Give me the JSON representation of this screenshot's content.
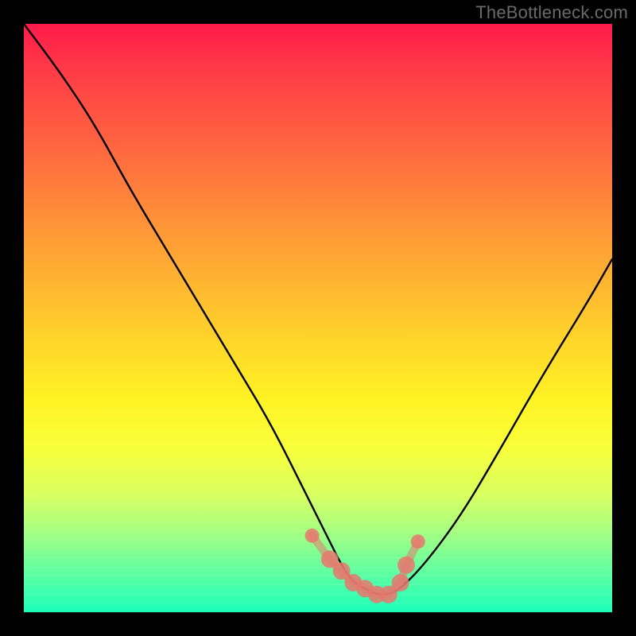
{
  "watermark": "TheBottleneck.com",
  "colors": {
    "frame": "#000000",
    "curve": "#000000",
    "marker": "#e6786f",
    "gradient_stops": [
      "#ff1a4a",
      "#ff3b47",
      "#ff6a3f",
      "#ff9a36",
      "#ffc92d",
      "#fff324",
      "#f8ff3a",
      "#d8ff60",
      "#a8ff80",
      "#6cff9c",
      "#1cffba"
    ]
  },
  "chart_data": {
    "type": "line",
    "title": "",
    "xlabel": "",
    "ylabel": "",
    "xlim": [
      0,
      100
    ],
    "ylim": [
      0,
      100
    ],
    "series": [
      {
        "name": "bottleneck-curve",
        "x": [
          0,
          6,
          12,
          18,
          24,
          30,
          36,
          42,
          48,
          52,
          54,
          56,
          58,
          60,
          62,
          64,
          68,
          74,
          80,
          88,
          96,
          100
        ],
        "y": [
          100,
          92,
          83,
          72,
          62,
          52,
          42,
          32,
          20,
          12,
          8,
          5,
          4,
          3,
          3,
          4,
          8,
          16,
          26,
          40,
          53,
          60
        ]
      }
    ],
    "markers": {
      "name": "min-region-markers",
      "x": [
        49,
        52,
        54,
        56,
        58,
        60,
        62,
        64,
        65,
        67
      ],
      "y": [
        13,
        9,
        7,
        5,
        4,
        3,
        3,
        5,
        8,
        12
      ]
    },
    "band_lines": {
      "count": 14,
      "y_start_frac": 0.8,
      "y_end_frac": 1.0
    }
  }
}
